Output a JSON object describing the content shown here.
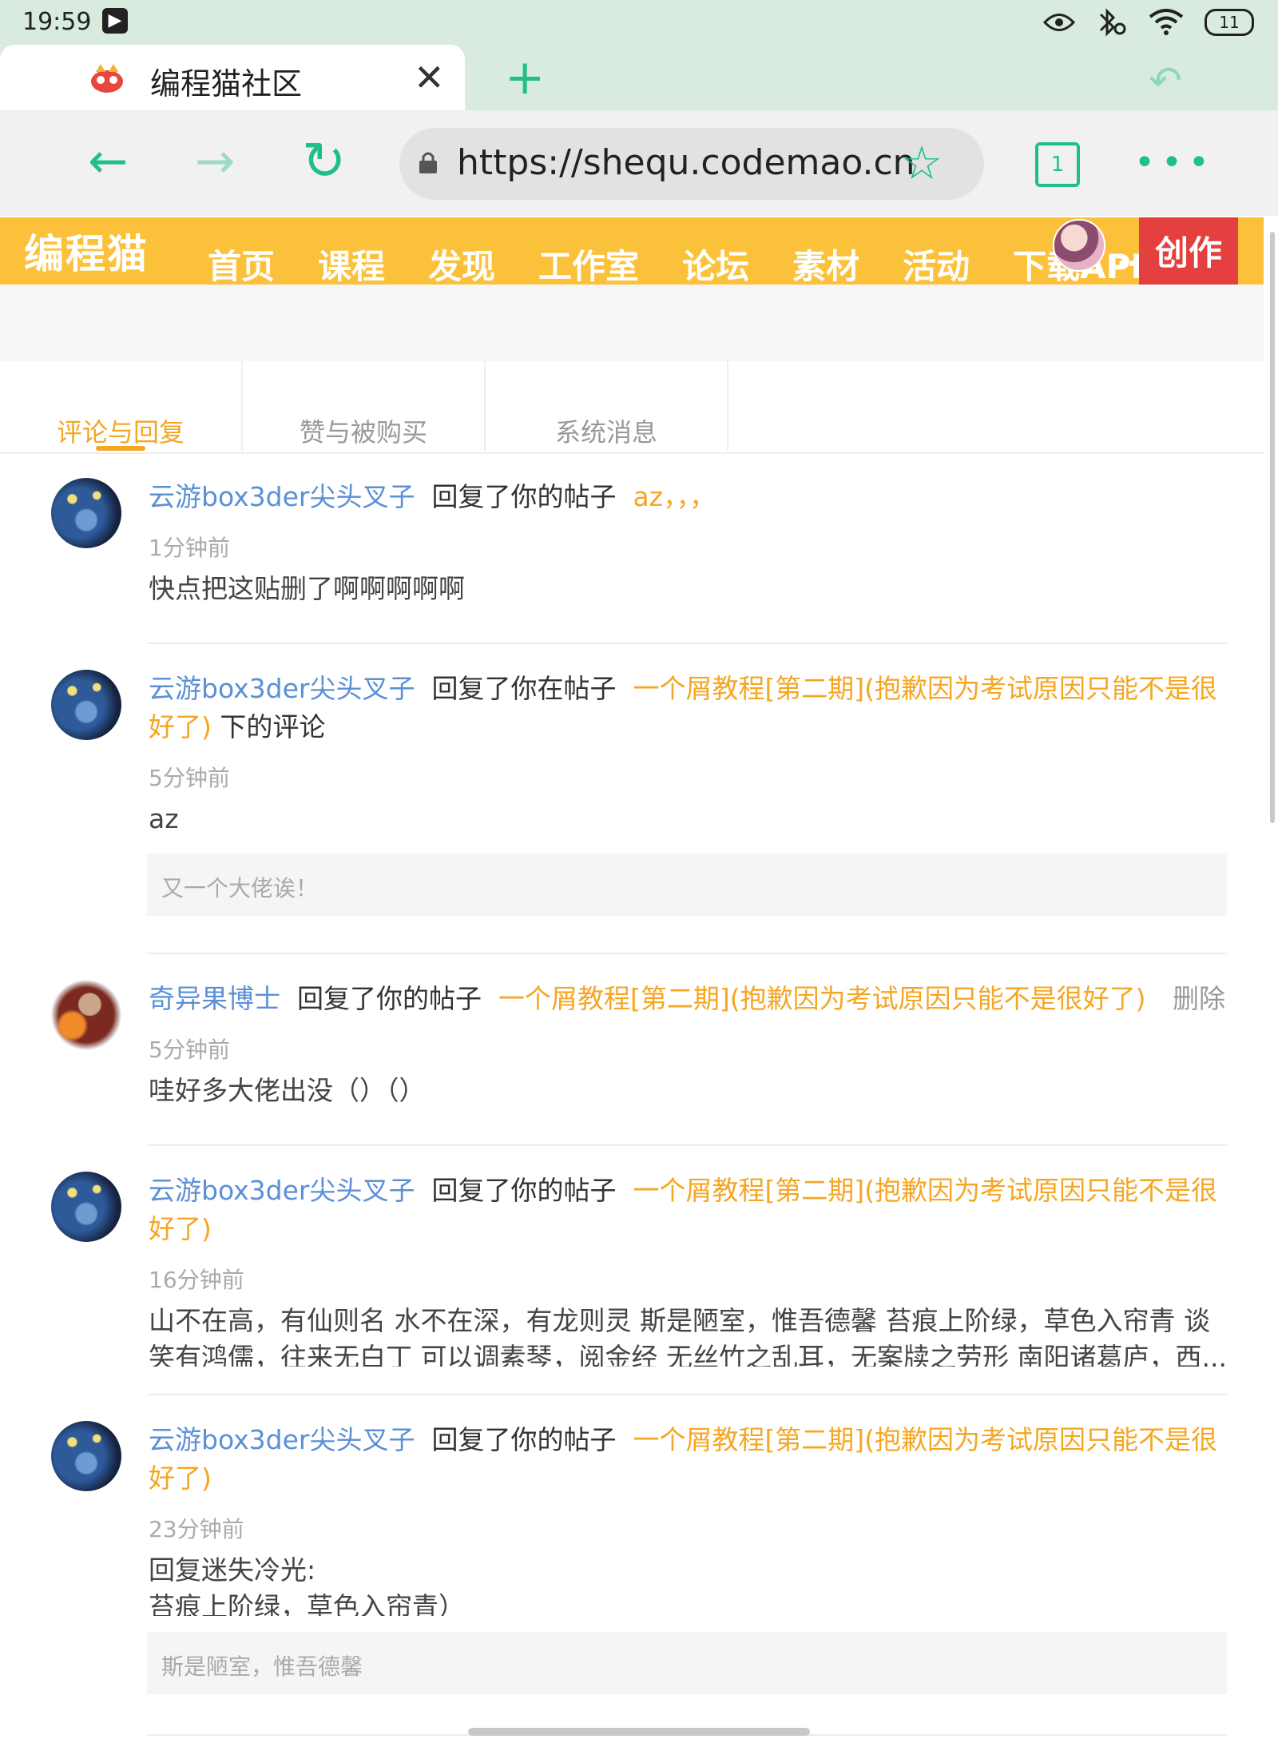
{
  "status_bar": {
    "time": "19:59",
    "battery": "11"
  },
  "browser": {
    "tab_title": "编程猫社区",
    "url": "https://shequ.codemao.cn",
    "tab_count": "1"
  },
  "site_nav": {
    "logo": "编程猫",
    "items": [
      "首页",
      "课程",
      "发现",
      "工作室",
      "论坛",
      "素材",
      "活动",
      "下载APP"
    ],
    "more": "..",
    "create": "创作"
  },
  "message_tabs": [
    "评论与回复",
    "赞与被购买",
    "系统消息"
  ],
  "messages": [
    {
      "user": "云游box3der尖头叉子",
      "action": "回复了你的帖子",
      "post": "az，，，",
      "suffix": "",
      "time": "1分钟前",
      "content": "快点把这贴删了啊啊啊啊啊",
      "quote": ""
    },
    {
      "user": "云游box3der尖头叉子",
      "action": "回复了你在帖子",
      "post": "一个屑教程[第二期](抱歉因为考试原因只能不是很好了)",
      "suffix": "下的评论",
      "time": "5分钟前",
      "content": "az",
      "quote": "又一个大佬诶！"
    },
    {
      "user": "奇异果博士",
      "action": "回复了你的帖子",
      "post": "一个屑教程[第二期](抱歉因为考试原因只能不是很好了)",
      "suffix": "",
      "delete": "删除",
      "time": "5分钟前",
      "content": "哇好多大佬出没（）（）",
      "quote": ""
    },
    {
      "user": "云游box3der尖头叉子",
      "action": "回复了你的帖子",
      "post": "一个屑教程[第二期](抱歉因为考试原因只能不是很好了)",
      "suffix": "",
      "time": "16分钟前",
      "content": "山不在高，有仙则名 水不在深，有龙则灵 斯是陋室，惟吾德馨 苔痕上阶绿，草色入帘青 谈笑有鸿儒，往来无白丁 可以调素琴，阅金经 无丝竹之乱耳，无案牍之劳形 南阳诸葛庐，西...",
      "quote": ""
    },
    {
      "user": "云游box3der尖头叉子",
      "action": "回复了你的帖子",
      "post": "一个屑教程[第二期](抱歉因为考试原因只能不是很好了)",
      "suffix": "",
      "time": "23分钟前",
      "content": "回复迷失冷光:\n苔痕上阶绿，草色入帘青）",
      "quote": "斯是陋室，惟吾德馨"
    }
  ]
}
